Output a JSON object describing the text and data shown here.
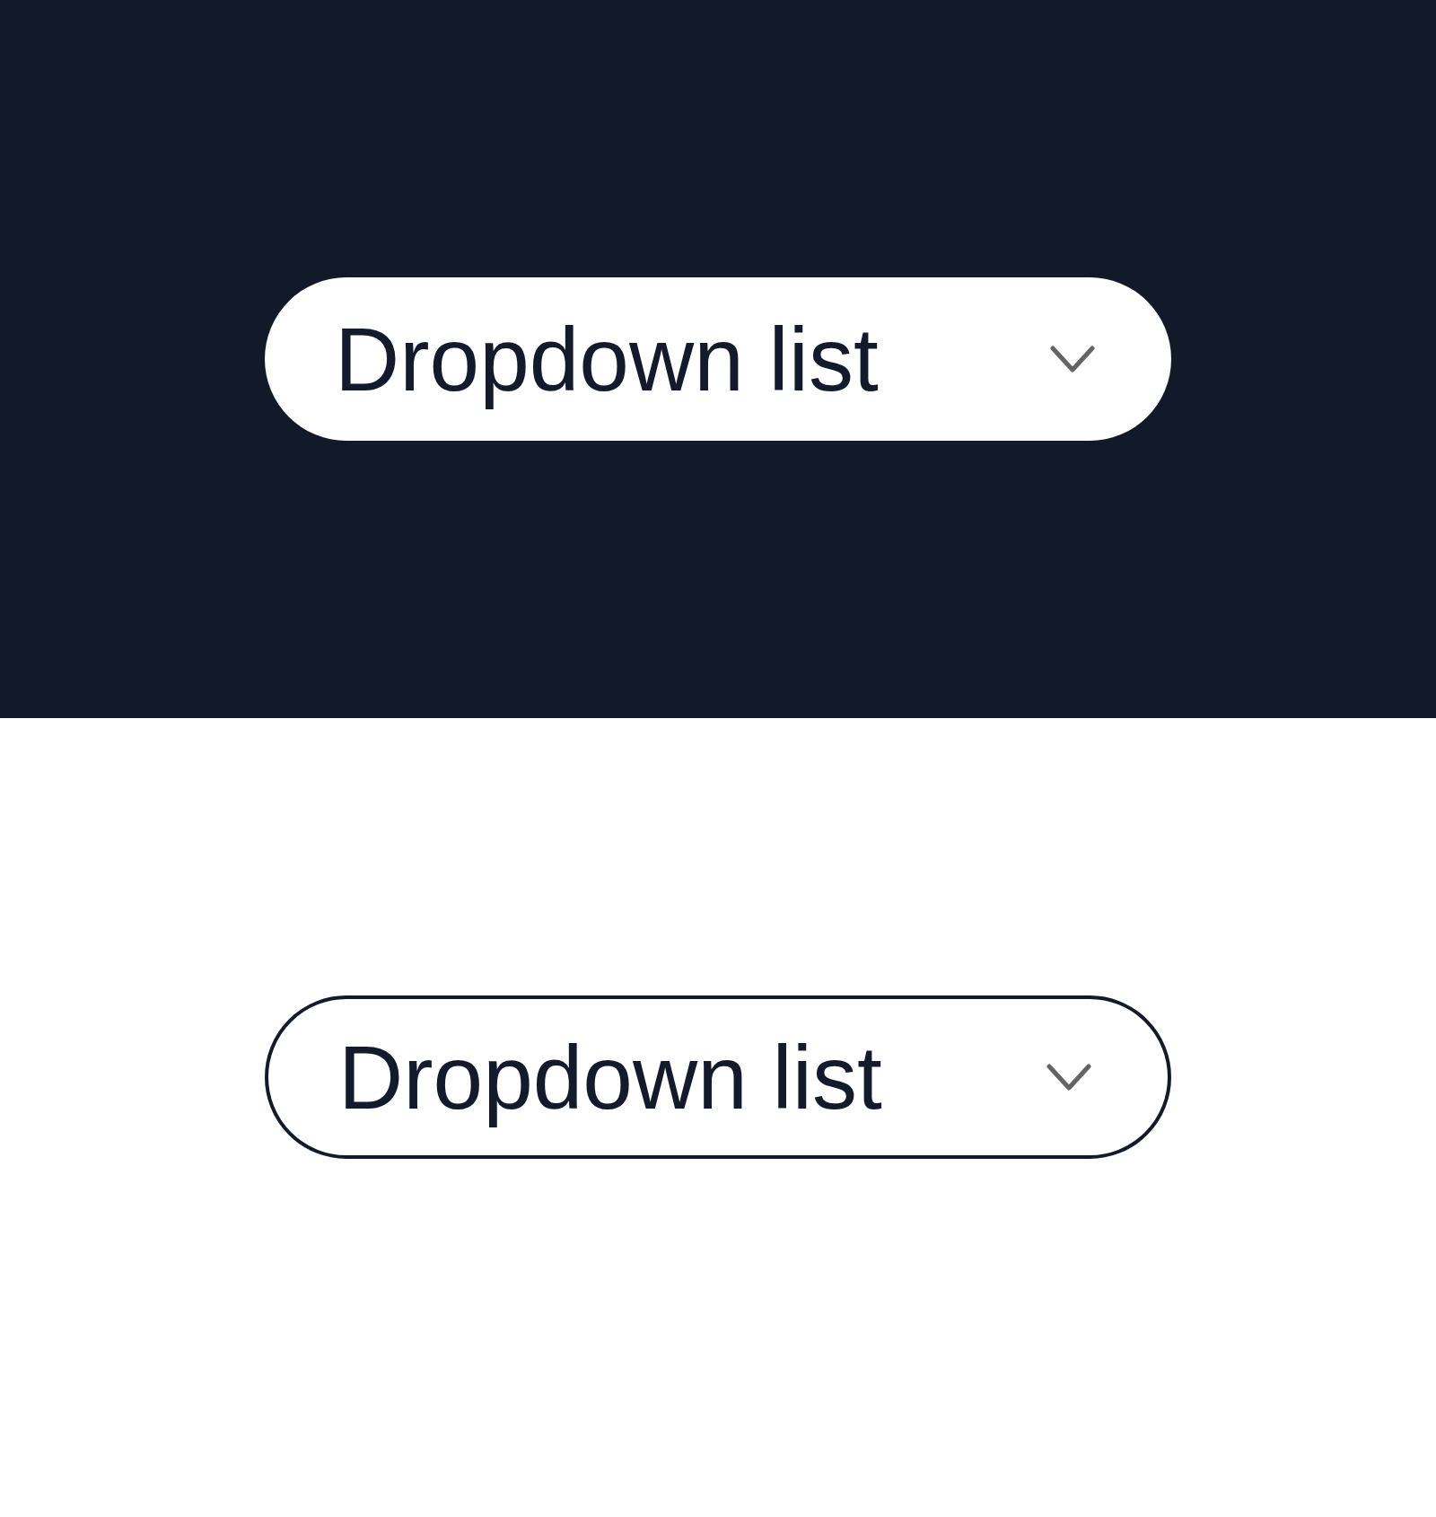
{
  "dropdowns": [
    {
      "kind": "filled",
      "label": "Dropdown list"
    },
    {
      "kind": "outlined",
      "label": "Dropdown list"
    }
  ]
}
